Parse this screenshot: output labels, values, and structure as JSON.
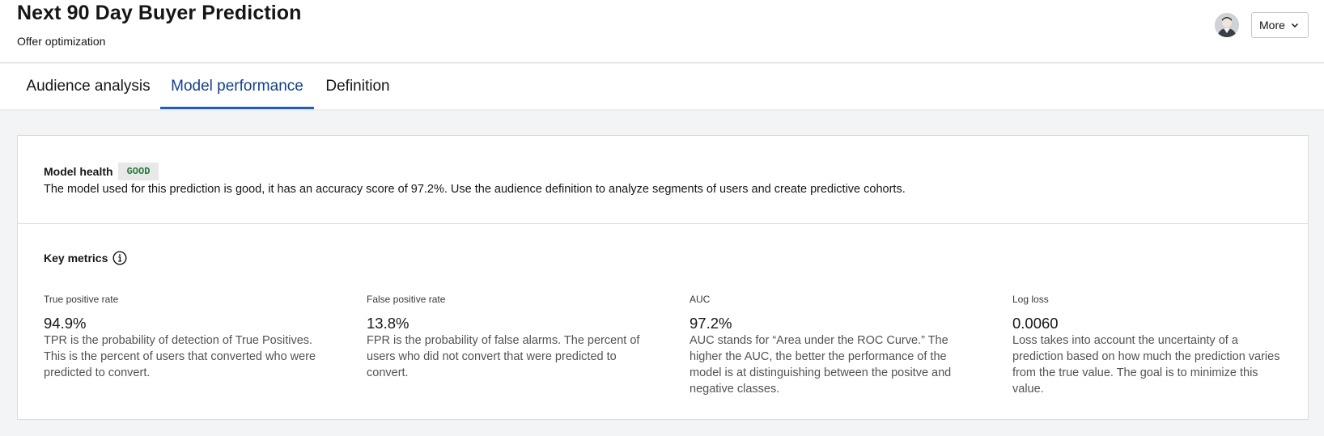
{
  "header": {
    "title": "Next 90 Day Buyer Prediction",
    "subtitle": "Offer optimization",
    "more_label": "More"
  },
  "tabs": [
    {
      "label": "Audience analysis",
      "active": false
    },
    {
      "label": "Model performance",
      "active": true
    },
    {
      "label": "Definition",
      "active": false
    }
  ],
  "model_health": {
    "label": "Model health",
    "status": "GOOD",
    "description": "The model used for this prediction is good, it has an accuracy score of 97.2%. Use the audience definition to analyze segments of users and create predictive cohorts."
  },
  "key_metrics": {
    "label": "Key metrics",
    "items": [
      {
        "title": "True positive rate",
        "value": "94.9%",
        "description": "TPR is the probability of detection of True Positives. This is the percent of users that converted who were predicted to convert."
      },
      {
        "title": "False positive rate",
        "value": "13.8%",
        "description": "FPR is the probability of false alarms. The percent of users who did not convert that were predicted to convert."
      },
      {
        "title": "AUC",
        "value": "97.2%",
        "description": "AUC stands for “Area under the ROC Curve.” The higher the AUC, the better the performance of the model is at distinguishing between the positve and negative classes."
      },
      {
        "title": "Log loss",
        "value": "0.0060",
        "description": "Loss takes into account the uncertainty of a prediction based on how much the prediction varies from the true value. The goal is to minimize this value."
      }
    ]
  },
  "colors": {
    "accent": "#1a5bd6",
    "active_tab_text": "#0f3f9e",
    "good_badge_text": "#1e7a3a",
    "page_background": "#f2f4f5"
  }
}
